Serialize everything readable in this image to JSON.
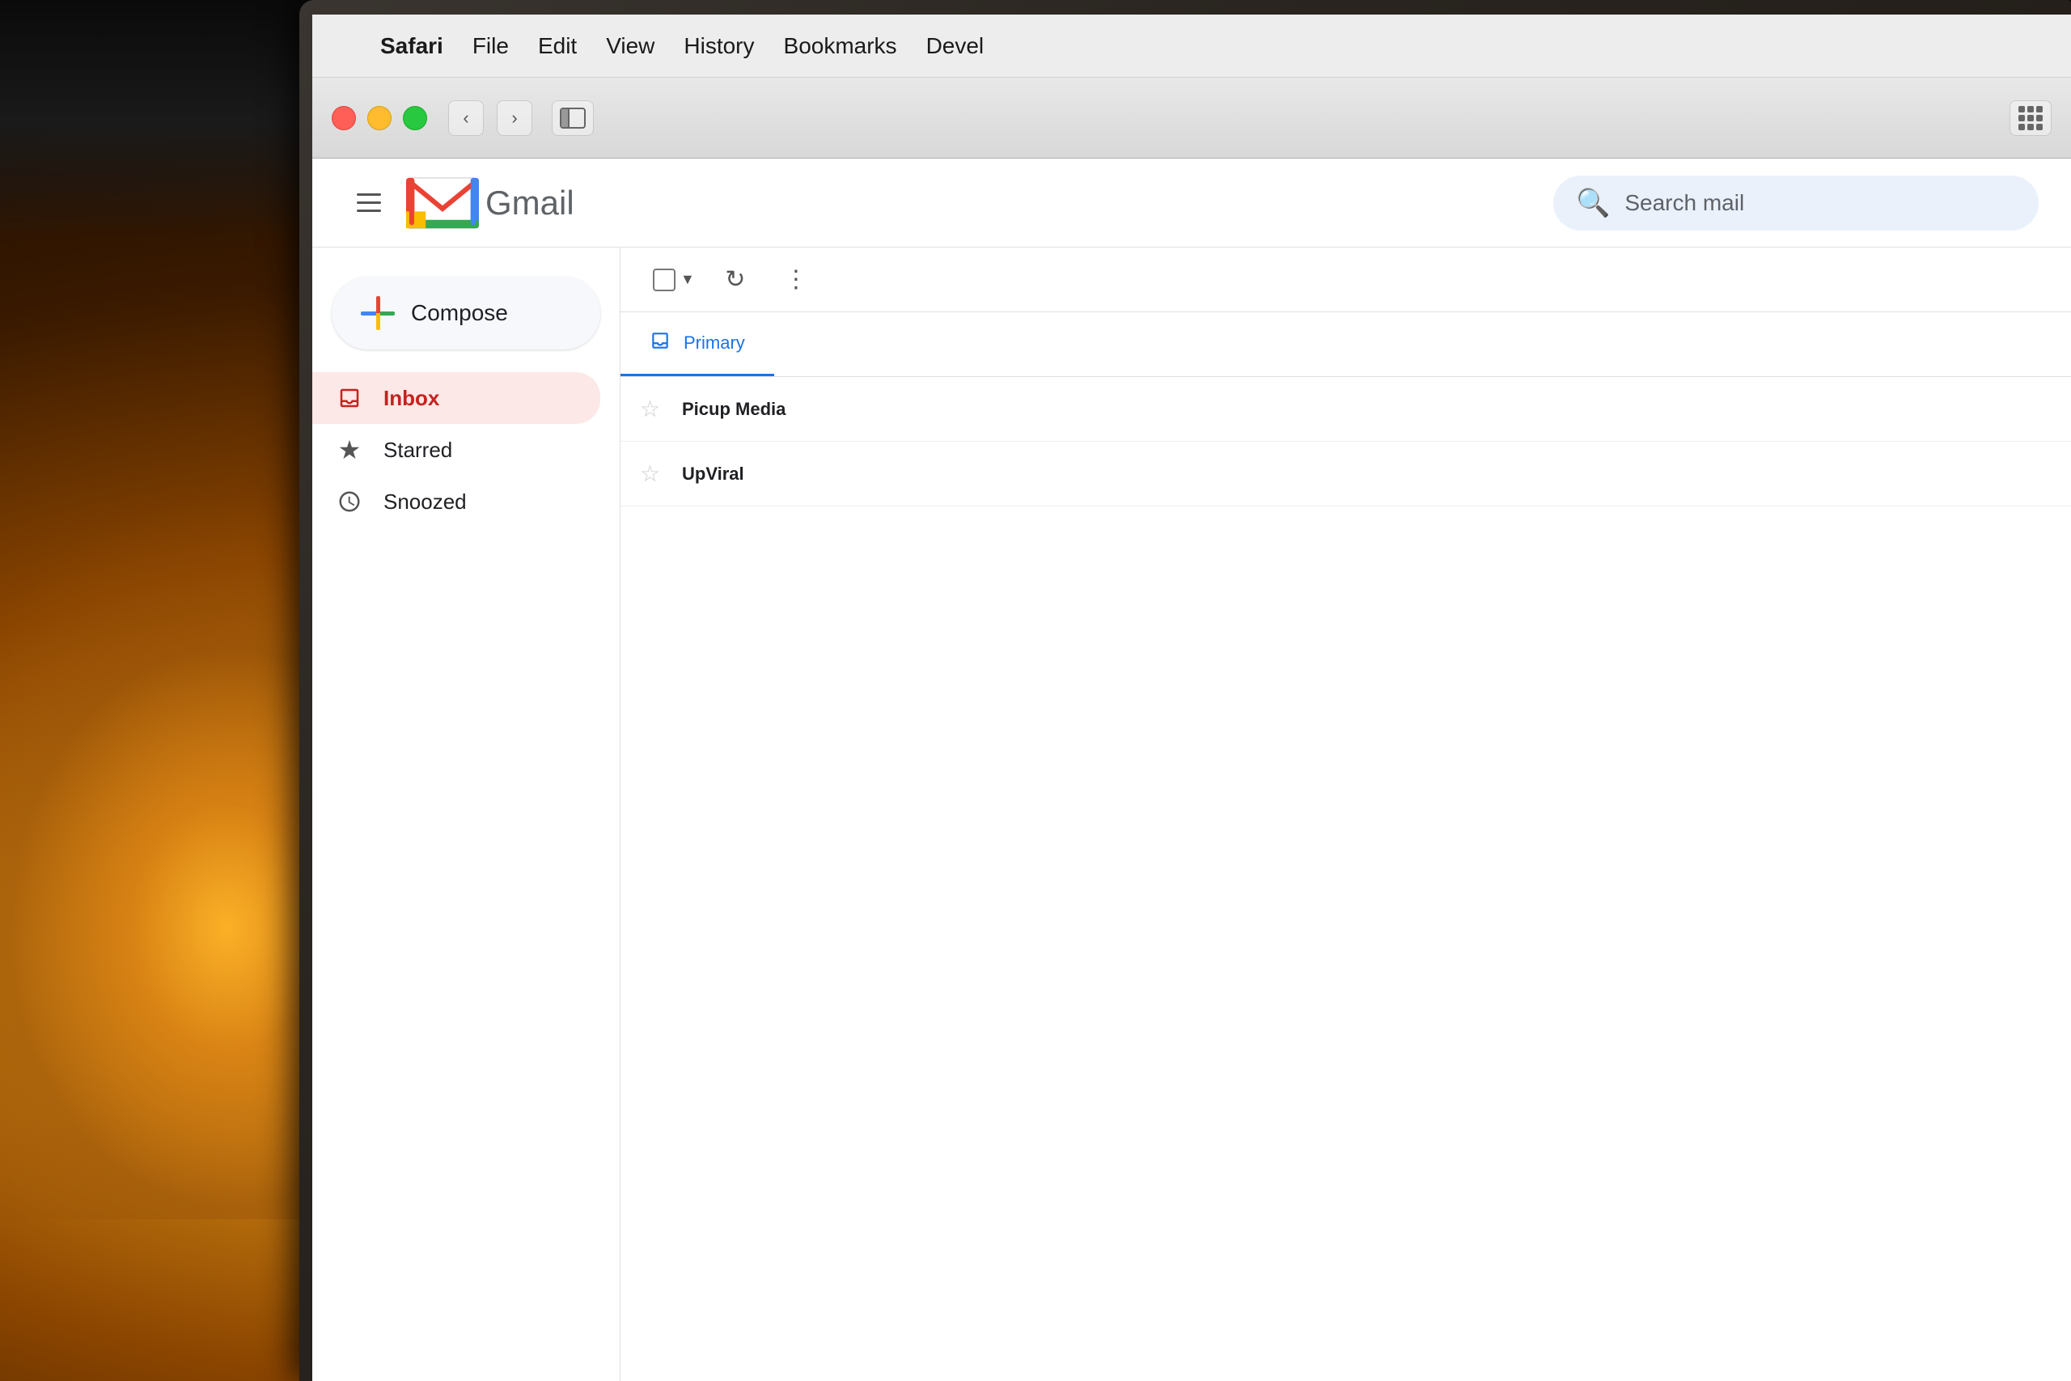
{
  "background": {
    "colors": {
      "bg_dark": "#1a1a1a",
      "glow_color": "#e8a020"
    }
  },
  "menubar": {
    "apple_symbol": "",
    "items": [
      {
        "label": "Safari",
        "bold": true
      },
      {
        "label": "File"
      },
      {
        "label": "Edit"
      },
      {
        "label": "View"
      },
      {
        "label": "History"
      },
      {
        "label": "Bookmarks"
      },
      {
        "label": "Devel"
      }
    ]
  },
  "browser": {
    "nav": {
      "back": "‹",
      "forward": "›"
    }
  },
  "gmail": {
    "header": {
      "menu_icon": "☰",
      "logo_text": "Gmail",
      "search_placeholder": "Search mail"
    },
    "toolbar": {
      "refresh_icon": "↻",
      "more_icon": "⋮"
    },
    "sidebar": {
      "compose_label": "Compose",
      "nav_items": [
        {
          "id": "inbox",
          "label": "Inbox",
          "icon": "🔖",
          "active": true
        },
        {
          "id": "starred",
          "label": "Starred",
          "icon": "★"
        },
        {
          "id": "snoozed",
          "label": "Snoozed",
          "icon": "🕐"
        }
      ]
    },
    "main": {
      "tabs": [
        {
          "id": "primary",
          "label": "Primary",
          "icon": "⊡",
          "active": true
        }
      ],
      "emails": [
        {
          "sender": "Picup Media",
          "starred": false
        },
        {
          "sender": "UpViral",
          "starred": false
        }
      ]
    }
  }
}
